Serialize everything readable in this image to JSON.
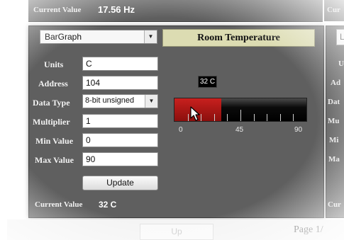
{
  "top": {
    "label": "Current Value",
    "value": "17.56 Hz"
  },
  "right_panel": {
    "top_label": "Cur",
    "select_value": "Li",
    "labels": [
      "U",
      "Ad",
      "Dat",
      "Mu",
      "Mi",
      "Ma"
    ],
    "current_label": "Cur"
  },
  "widget": {
    "type_select": "BarGraph",
    "fields": {
      "units": {
        "label": "Units",
        "value": "C"
      },
      "address": {
        "label": "Address",
        "value": "104"
      },
      "data_type": {
        "label": "Data Type",
        "value": "8-bit unsigned"
      },
      "multiplier": {
        "label": "Multiplier",
        "value": "1"
      },
      "min": {
        "label": "Min Value",
        "value": "0"
      },
      "max": {
        "label": "Max Value",
        "value": "90"
      }
    },
    "update_label": "Update",
    "current_label": "Current Value",
    "current_value": "32 C"
  },
  "display": {
    "title": "Room Temperature",
    "value_tag": "32 C",
    "bar": {
      "value": 32,
      "min": 0,
      "max": 90,
      "tick_labels": [
        "0",
        "45",
        "90"
      ]
    }
  },
  "pager": {
    "up_label": "Up",
    "page_text": "Page 1/"
  },
  "colors": {
    "panel": "#5f5f5f",
    "bar_fill": "#b01a18",
    "title_bg": "#dcdcb2"
  },
  "icons": {
    "cursor": "mouse-pointer-icon",
    "dropdown": "chevron-down-icon"
  }
}
